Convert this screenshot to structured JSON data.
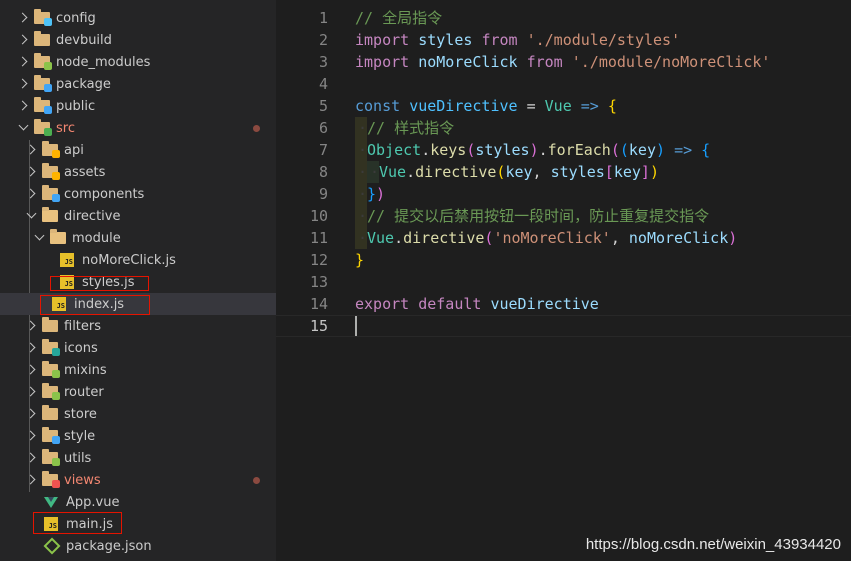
{
  "sidebar": {
    "items": [
      {
        "label": "config",
        "chevron": "right",
        "icon": "folder-config",
        "badge": "#4fc3f7"
      },
      {
        "label": "devbuild",
        "chevron": "right",
        "icon": "folder"
      },
      {
        "label": "node_modules",
        "chevron": "right",
        "icon": "folder-node",
        "badge": "#8bc34a"
      },
      {
        "label": "package",
        "chevron": "right",
        "icon": "folder-package",
        "badge": "#42a5f5"
      },
      {
        "label": "public",
        "chevron": "right",
        "icon": "folder-public",
        "badge": "#42a5f5"
      },
      {
        "label": "src",
        "chevron": "down",
        "icon": "folder-src",
        "badge": "#4caf50",
        "modified": true
      },
      {
        "label": "api",
        "chevron": "right",
        "icon": "folder-api",
        "badge": "#ffb300"
      },
      {
        "label": "assets",
        "chevron": "right",
        "icon": "folder-assets",
        "badge": "#ffb300"
      },
      {
        "label": "components",
        "chevron": "right",
        "icon": "folder-components",
        "badge": "#42a5f5"
      },
      {
        "label": "directive",
        "chevron": "down",
        "icon": "folder-open"
      },
      {
        "label": "module",
        "chevron": "down",
        "icon": "folder-open"
      },
      {
        "label": "noMoreClick.js",
        "chevron": "none",
        "icon": "js-file"
      },
      {
        "label": "styles.js",
        "chevron": "none",
        "icon": "js-file"
      },
      {
        "label": "index.js",
        "chevron": "none",
        "icon": "js-file",
        "selected": true
      },
      {
        "label": "filters",
        "chevron": "right",
        "icon": "folder"
      },
      {
        "label": "icons",
        "chevron": "right",
        "icon": "folder-icons",
        "badge": "#26a69a"
      },
      {
        "label": "mixins",
        "chevron": "right",
        "icon": "folder-mixins",
        "badge": "#8bc34a"
      },
      {
        "label": "router",
        "chevron": "right",
        "icon": "folder-router",
        "badge": "#8bc34a"
      },
      {
        "label": "store",
        "chevron": "right",
        "icon": "folder"
      },
      {
        "label": "style",
        "chevron": "right",
        "icon": "folder-style",
        "badge": "#42a5f5"
      },
      {
        "label": "utils",
        "chevron": "right",
        "icon": "folder-utils",
        "badge": "#8bc34a"
      },
      {
        "label": "views",
        "chevron": "right",
        "icon": "folder-views",
        "badge": "#ef5350",
        "modified": true
      },
      {
        "label": "App.vue",
        "chevron": "none",
        "icon": "vue-file"
      },
      {
        "label": "main.js",
        "chevron": "none",
        "icon": "js-file"
      },
      {
        "label": "package.json",
        "chevron": "none",
        "icon": "json-file"
      }
    ]
  },
  "editor": {
    "current_line": 15,
    "lines": [
      {
        "n": "1",
        "tokens": [
          [
            "tk-comment",
            "// 全局指令"
          ]
        ]
      },
      {
        "n": "2",
        "tokens": [
          [
            "tk-keyword",
            "import"
          ],
          [
            "tk-op",
            " "
          ],
          [
            "tk-var",
            "styles"
          ],
          [
            "tk-op",
            " "
          ],
          [
            "tk-keyword",
            "from"
          ],
          [
            "tk-op",
            " "
          ],
          [
            "tk-string",
            "'./module/styles'"
          ]
        ]
      },
      {
        "n": "3",
        "tokens": [
          [
            "tk-keyword",
            "import"
          ],
          [
            "tk-op",
            " "
          ],
          [
            "tk-var",
            "noMoreClick"
          ],
          [
            "tk-op",
            " "
          ],
          [
            "tk-keyword",
            "from"
          ],
          [
            "tk-op",
            " "
          ],
          [
            "tk-string",
            "'./module/noMoreClick'"
          ]
        ]
      },
      {
        "n": "4",
        "tokens": []
      },
      {
        "n": "5",
        "tokens": [
          [
            "tk-storage",
            "const"
          ],
          [
            "tk-op",
            " "
          ],
          [
            "tk-const",
            "vueDirective"
          ],
          [
            "tk-op",
            " = "
          ],
          [
            "tk-class",
            "Vue"
          ],
          [
            "tk-op",
            " "
          ],
          [
            "tk-arrow",
            "=>"
          ],
          [
            "tk-op",
            " "
          ],
          [
            "tk-paren1",
            "{"
          ]
        ]
      },
      {
        "n": "6",
        "indent": 1,
        "tokens": [
          [
            "tk-comment",
            "// 样式指令"
          ]
        ]
      },
      {
        "n": "7",
        "indent": 1,
        "tokens": [
          [
            "tk-class",
            "Object"
          ],
          [
            "tk-op",
            "."
          ],
          [
            "tk-fn",
            "keys"
          ],
          [
            "tk-paren2",
            "("
          ],
          [
            "tk-var",
            "styles"
          ],
          [
            "tk-paren2",
            ")"
          ],
          [
            "tk-op",
            "."
          ],
          [
            "tk-fn",
            "forEach"
          ],
          [
            "tk-paren2",
            "("
          ],
          [
            "tk-paren3",
            "("
          ],
          [
            "tk-var",
            "key"
          ],
          [
            "tk-paren3",
            ")"
          ],
          [
            "tk-op",
            " "
          ],
          [
            "tk-arrow",
            "=>"
          ],
          [
            "tk-op",
            " "
          ],
          [
            "tk-paren3",
            "{"
          ]
        ]
      },
      {
        "n": "8",
        "indent": 2,
        "tokens": [
          [
            "tk-class",
            "Vue"
          ],
          [
            "tk-op",
            "."
          ],
          [
            "tk-fn",
            "directive"
          ],
          [
            "tk-paren1",
            "("
          ],
          [
            "tk-var",
            "key"
          ],
          [
            "tk-op",
            ", "
          ],
          [
            "tk-var",
            "styles"
          ],
          [
            "tk-paren2",
            "["
          ],
          [
            "tk-var",
            "key"
          ],
          [
            "tk-paren2",
            "]"
          ],
          [
            "tk-paren1",
            ")"
          ]
        ]
      },
      {
        "n": "9",
        "indent": 1,
        "tokens": [
          [
            "tk-paren3",
            "}"
          ],
          [
            "tk-paren2",
            ")"
          ]
        ]
      },
      {
        "n": "10",
        "indent": 1,
        "tokens": [
          [
            "tk-comment",
            "// 提交以后禁用按钮一段时间，防止重复提交指令"
          ]
        ]
      },
      {
        "n": "11",
        "indent": 1,
        "tokens": [
          [
            "tk-class",
            "Vue"
          ],
          [
            "tk-op",
            "."
          ],
          [
            "tk-fn",
            "directive"
          ],
          [
            "tk-paren2",
            "("
          ],
          [
            "tk-string",
            "'noMoreClick'"
          ],
          [
            "tk-op",
            ", "
          ],
          [
            "tk-var",
            "noMoreClick"
          ],
          [
            "tk-paren2",
            ")"
          ]
        ]
      },
      {
        "n": "12",
        "tokens": [
          [
            "tk-paren1",
            "}"
          ]
        ]
      },
      {
        "n": "13",
        "tokens": []
      },
      {
        "n": "14",
        "tokens": [
          [
            "tk-keyword",
            "export"
          ],
          [
            "tk-op",
            " "
          ],
          [
            "tk-keyword",
            "default"
          ],
          [
            "tk-op",
            " "
          ],
          [
            "tk-var",
            "vueDirective"
          ]
        ]
      },
      {
        "n": "15",
        "tokens": []
      }
    ]
  },
  "watermark": "https://blog.csdn.net/weixin_43934420",
  "colors": {
    "highlight_box": "#e51400",
    "modified_dot": "#8b4a40",
    "folder": "#dcb67a"
  }
}
